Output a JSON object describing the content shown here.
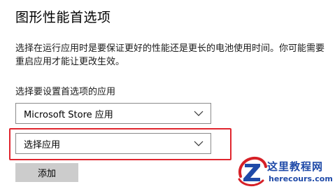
{
  "page": {
    "title": "图形性能首选项",
    "description": "选择在运行应用时是要保证更好的性能还是更长的电池使用时间。你可能需要重启应用才能让更改生效。"
  },
  "app_picker": {
    "label": "选择要设置首选项的应用",
    "app_type_selected": "Microsoft Store 应用",
    "app_selected": "选择应用",
    "add_button_label": "添加"
  },
  "annotation": {
    "highlight_color": "#e0262f"
  },
  "watermark": {
    "title": "这里教程网",
    "domain": "herecours.com",
    "color": "#1f4aa8"
  },
  "icons": {
    "dropdown_arrow": "chevron-down-icon",
    "watermark_logo": "z-logo-icon"
  }
}
